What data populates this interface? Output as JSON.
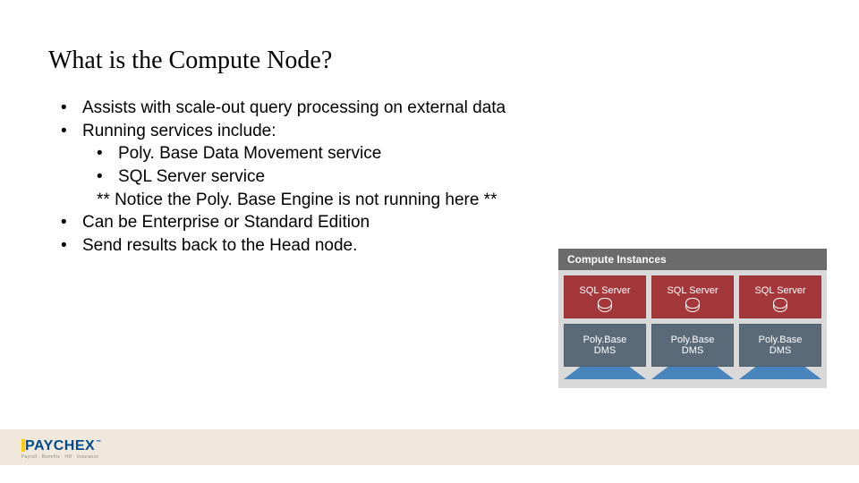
{
  "title": "What is the Compute Node?",
  "bullets": {
    "b1": "Assists with scale-out query processing on external data",
    "b2": "Running services include:",
    "b2a": "Poly. Base Data Movement service",
    "b2b": "SQL Server service",
    "b2note": "** Notice the Poly. Base Engine is not running here **",
    "b3": "Can be Enterprise or Standard Edition",
    "b4": "Send results back to the Head node."
  },
  "diagram": {
    "header": "Compute Instances",
    "sql_label": "SQL Server",
    "dms_line1": "Poly.Base",
    "dms_line2": "DMS"
  },
  "logo": {
    "pay": "PAY",
    "chex": "CHEX",
    "tm": "™",
    "tagline": "Payroll · Benefits · HR · Insurance"
  },
  "colors": {
    "sql_box": "#a4373a",
    "dms_box": "#5b6a78",
    "footer_band": "#f1e8dc",
    "logo_blue": "#004b8d",
    "logo_yellow": "#ffcc00"
  }
}
